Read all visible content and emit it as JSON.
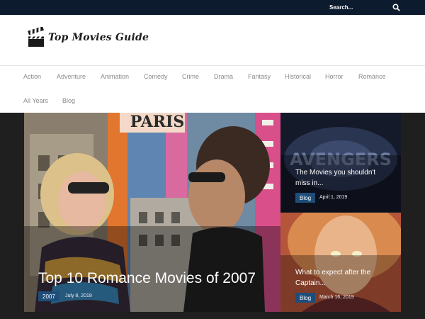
{
  "search": {
    "placeholder": "Search..."
  },
  "site": {
    "logo_text": "Top Movies Guide"
  },
  "nav": {
    "row1": [
      "Action",
      "Adventure",
      "Animation",
      "Comedy",
      "Crime",
      "Drama",
      "Fantasy",
      "Historical",
      "Horror",
      "Romance"
    ],
    "row2": [
      "All Years",
      "Blog"
    ]
  },
  "featured": {
    "main": {
      "title": "Top 10 Romance Movies of 2007",
      "tag": "2007",
      "date": "July 8, 2019",
      "sign_text": "PARIS"
    },
    "side": [
      {
        "title": "The Movies you shouldn't miss in...",
        "tag": "Blog",
        "date": "April 1, 2019",
        "image_text": "AVENGERS"
      },
      {
        "title": "What to expect after the Captain...",
        "tag": "Blog",
        "date": "March 16, 2019"
      }
    ]
  }
}
